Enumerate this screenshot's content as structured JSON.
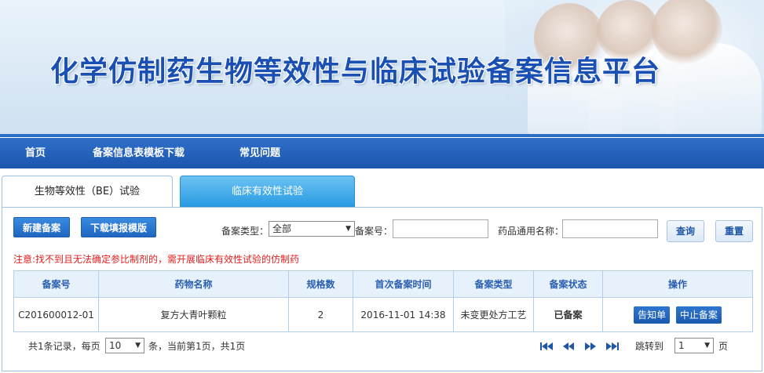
{
  "header": {
    "title": "化学仿制药生物等效性与临床试验备案信息平台"
  },
  "nav": {
    "items": [
      "首页",
      "备案信息表模板下载",
      "常见问题"
    ]
  },
  "tabs": [
    {
      "label": "生物等效性（BE）试验",
      "active": true
    },
    {
      "label": "临床有效性试验",
      "active": false
    }
  ],
  "toolbar": {
    "new_label": "新建备案",
    "download_label": "下载填报模版",
    "type_label": "备案类型：",
    "type_value": "全部",
    "number_label": "备案号：",
    "number_value": "",
    "drug_label": "药品通用名称：",
    "drug_value": "",
    "search_label": "查询",
    "reset_label": "重置"
  },
  "notice": "注意:找不到且无法确定参比制剂的，需开展临床有效性试验的仿制药",
  "table": {
    "columns": [
      "备案号",
      "药物名称",
      "规格数",
      "首次备案时间",
      "备案类型",
      "备案状态",
      "操作"
    ],
    "rows": [
      {
        "number": "C201600012-01",
        "drug": "复方大青叶颗粒",
        "specs": "2",
        "first_time": "2016-11-01 14:38",
        "type": "未变更处方工艺",
        "status": "已备案",
        "actions": [
          "告知单",
          "中止备案"
        ]
      }
    ]
  },
  "pagination": {
    "total_prefix": "共1条记录，每页",
    "page_size": "10",
    "total_suffix": "条，当前第1页，共1页",
    "jump_label": "跳转到",
    "jump_value": "1",
    "page_unit": "页"
  },
  "colors": {
    "primary": "#1f66c1",
    "nav": "#1c56ad",
    "title": "#1a4fb3",
    "notice": "#e02020",
    "status_ok": "#1d9a1d"
  }
}
